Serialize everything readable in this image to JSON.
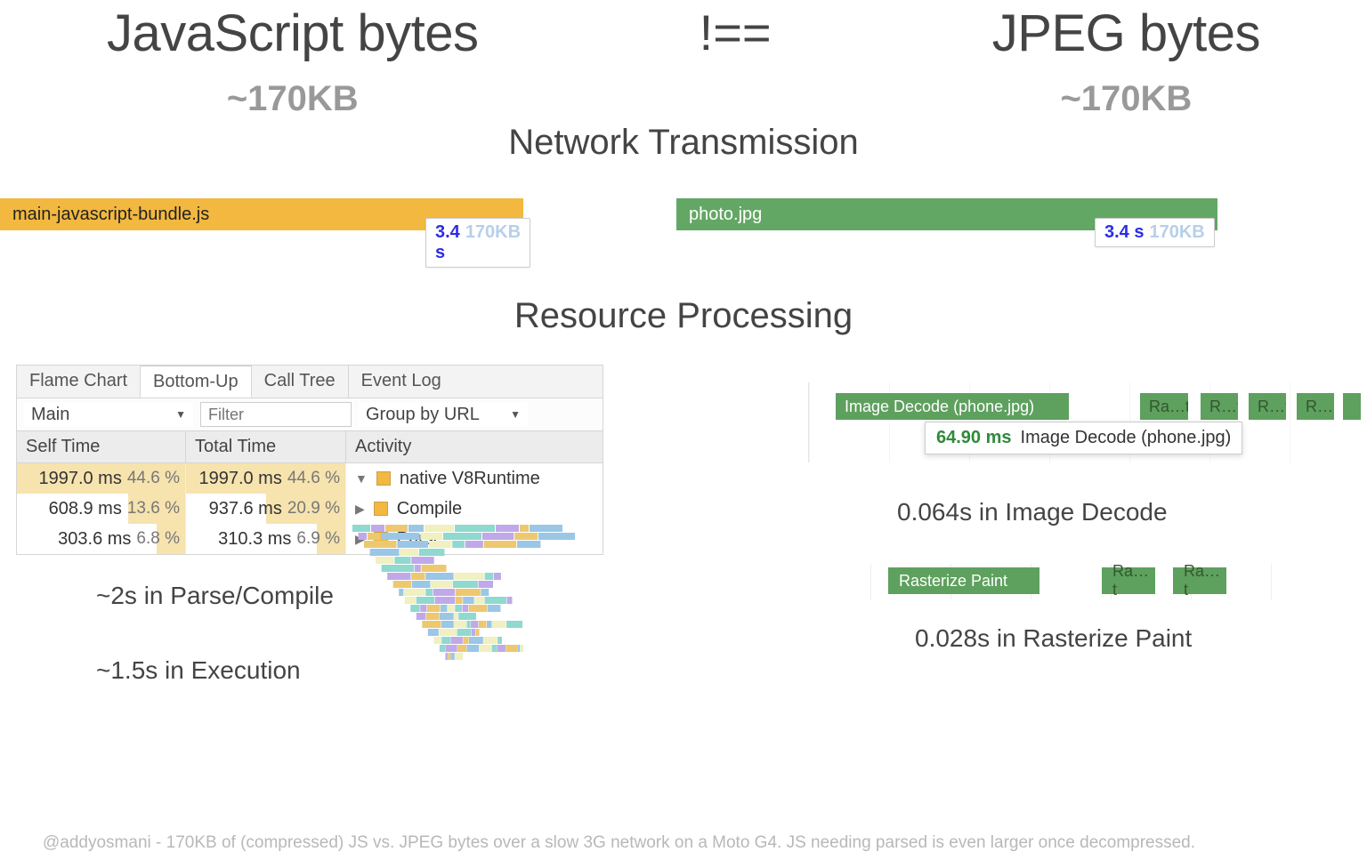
{
  "header": {
    "left_title": "JavaScript bytes",
    "neq": "!==",
    "right_title": "JPEG bytes",
    "left_kb": "~170KB",
    "right_kb": "~170KB",
    "section1": "Network Transmission"
  },
  "bars": {
    "js_label": "main-javascript-bundle.js",
    "img_label": "photo.jpg",
    "js_time": "3.4 s",
    "js_size": "170KB",
    "img_time": "3.4 s",
    "img_size": "170KB"
  },
  "section2": "Resource Processing",
  "devtools": {
    "tabs": [
      "Flame Chart",
      "Bottom-Up",
      "Call Tree",
      "Event Log"
    ],
    "active_tab_index": 1,
    "thread_select": "Main",
    "filter_placeholder": "Filter",
    "group_select": "Group by URL",
    "columns": [
      "Self Time",
      "Total Time",
      "Activity"
    ],
    "rows": [
      {
        "self_ms": "1997.0 ms",
        "self_pct": "44.6 %",
        "self_bar": 100,
        "total_ms": "1997.0 ms",
        "total_pct": "44.6 %",
        "total_bar": 100,
        "arrow": "▼",
        "activity": "native V8Runtime"
      },
      {
        "self_ms": "608.9 ms",
        "self_pct": "13.6 %",
        "self_bar": 34,
        "total_ms": "937.6 ms",
        "total_pct": "20.9 %",
        "total_bar": 50,
        "arrow": "▶",
        "activity": "Compile"
      },
      {
        "self_ms": "303.6 ms",
        "self_pct": "6.8 %",
        "self_bar": 17,
        "total_ms": "310.3 ms",
        "total_pct": "6.9 %",
        "total_bar": 18,
        "arrow": "▶",
        "activity": "Parse"
      }
    ]
  },
  "js_summary1": "~2s in Parse/Compile",
  "js_summary2": "~1.5s in Execution",
  "img_timeline": {
    "main_block": "Image Decode (phone.jpg)",
    "short_blocks": [
      "Ra…t",
      "R…t",
      "R…t",
      "R…",
      "R"
    ],
    "tooltip_ms": "64.90 ms",
    "tooltip_label": "Image Decode (phone.jpg)"
  },
  "img_summary1": "0.064s in Image Decode",
  "raster": {
    "main": "Rasterize Paint",
    "short": [
      "Ra…t",
      "Ra…t"
    ]
  },
  "img_summary2": "0.028s in Rasterize Paint",
  "footer": "@addyosmani - 170KB of (compressed) JS vs. JPEG bytes over a slow 3G network on a Moto G4. JS needing parsed is even larger once decompressed."
}
